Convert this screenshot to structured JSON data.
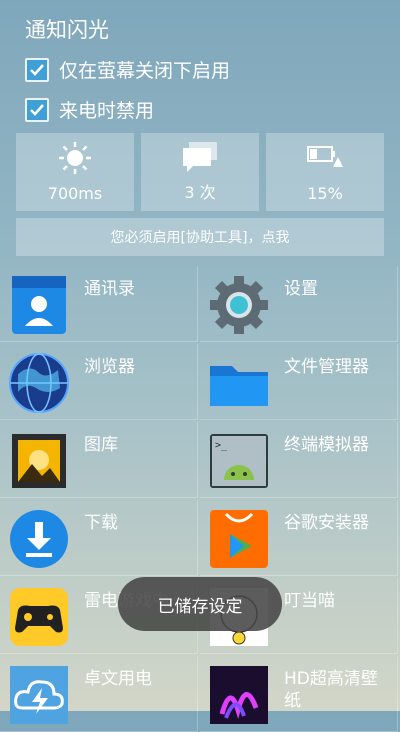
{
  "header": {
    "title": "通知闪光",
    "option_screen_off": "仅在萤幕关闭下启用",
    "option_call_disable": "来电时禁用"
  },
  "tiles": [
    {
      "icon": "brightness-sun-icon",
      "value": "700ms"
    },
    {
      "icon": "message-stack-icon",
      "value": "3 次"
    },
    {
      "icon": "battery-warning-icon",
      "value": "15%"
    }
  ],
  "notice": "您必须启用[协助工具]，点我",
  "apps": [
    {
      "icon": "contacts-icon",
      "label": "通讯录"
    },
    {
      "icon": "settings-gear-icon",
      "label": "设置"
    },
    {
      "icon": "browser-globe-icon",
      "label": "浏览器"
    },
    {
      "icon": "folder-icon",
      "label": "文件管理器"
    },
    {
      "icon": "gallery-icon",
      "label": "图库"
    },
    {
      "icon": "terminal-android-icon",
      "label": "终端模拟器"
    },
    {
      "icon": "download-icon",
      "label": "下载"
    },
    {
      "icon": "play-installer-icon",
      "label": "谷歌安装器"
    },
    {
      "icon": "gamepad-icon",
      "label": "雷电游戏中心"
    },
    {
      "icon": "cat-icon",
      "label": "叮当喵"
    },
    {
      "icon": "cloud-charge-icon",
      "label": "卓文用电"
    },
    {
      "icon": "wallpaper-icon",
      "label": "HD超高清壁纸"
    }
  ],
  "toast": "已储存设定",
  "colors": {
    "accent": "#3f9fd6",
    "toast_bg": "#464646"
  }
}
